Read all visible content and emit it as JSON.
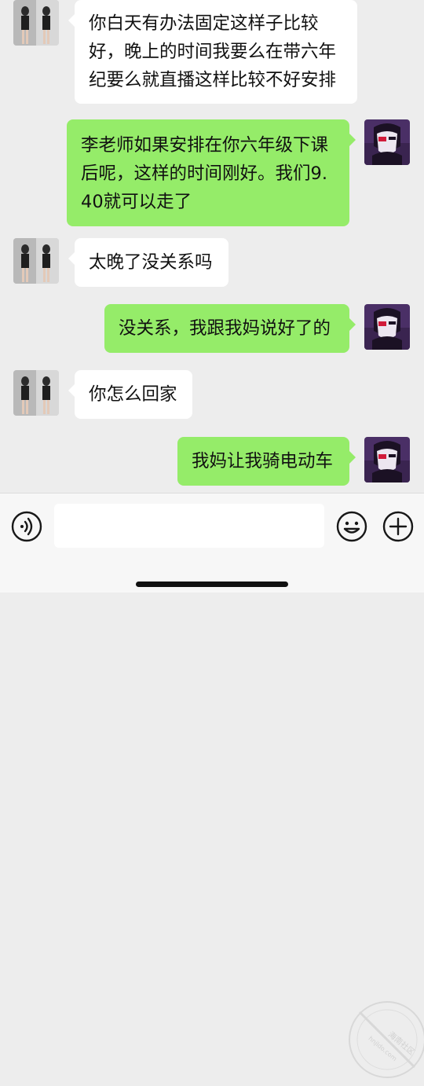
{
  "messages": [
    {
      "side": "in",
      "text": "你白天有办法固定这样子比较好，晚上的时间我要么在带六年纪要么就直播这样比较不好安排"
    },
    {
      "side": "out",
      "text": "李老师如果安排在你六年级下课后呢，这样的时间刚好。我们9.40就可以走了"
    },
    {
      "side": "in",
      "text": "太晚了没关系吗"
    },
    {
      "side": "out",
      "text": "没关系，我跟我妈说好了的"
    },
    {
      "side": "in",
      "text": "你怎么回家"
    },
    {
      "side": "out",
      "text": "我妈让我骑电动车"
    }
  ],
  "input_bar": {
    "voice_icon": "voice-icon",
    "emoji_icon": "emoji-icon",
    "plus_icon": "plus-icon",
    "text_value": ""
  },
  "watermark": {
    "text": "海南社区",
    "subtext": "hnjldo.com"
  },
  "colors": {
    "background": "#ededed",
    "incoming_bubble": "#ffffff",
    "outgoing_bubble": "#95ec69"
  }
}
